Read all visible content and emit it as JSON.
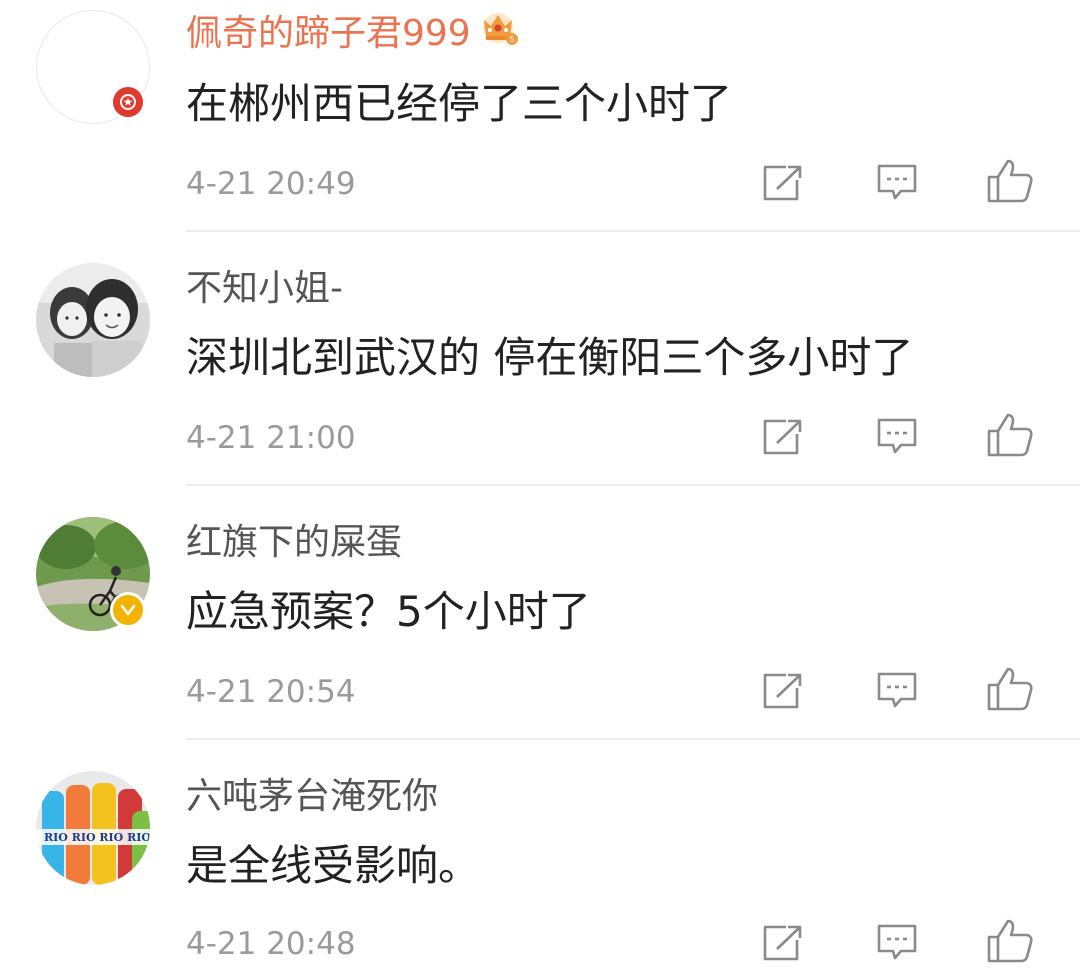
{
  "comments": [
    {
      "username": "佩奇的蹄子君999",
      "text": "在郴州西已经停了三个小时了",
      "time": "4-21 20:49"
    },
    {
      "username": "不知小姐-",
      "text": "深圳北到武汉的 停在衡阳三个多小时了",
      "time": "4-21 21:00"
    },
    {
      "username": "红旗下的屎蛋",
      "text": "应急预案？5个小时了",
      "time": "4-21 20:54"
    },
    {
      "username": "六吨茅台淹死你",
      "text": "是全线受影响。",
      "time": "4-21 20:48"
    }
  ],
  "colors": {
    "vip_username": "#eb7350",
    "username": "#555555",
    "text": "#222222",
    "time": "#9a9a9a",
    "icon": "#8a8a8a",
    "badge_red": "#e03a2f",
    "badge_yellow": "#f5b301"
  },
  "icons": {
    "repost": "share-box-icon",
    "reply": "comment-icon",
    "like": "thumbs-up-icon",
    "crown": "crown-icon"
  }
}
